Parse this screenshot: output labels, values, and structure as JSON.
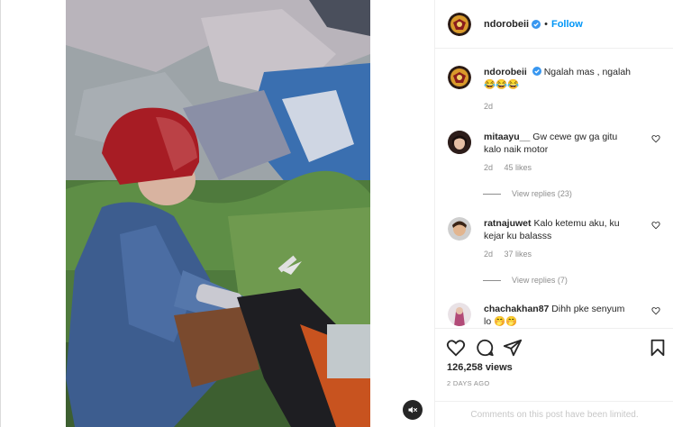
{
  "post": {
    "username": "ndorobeii",
    "follow_label": "Follow",
    "dot": "•"
  },
  "caption": {
    "username": "ndorobeii",
    "text": "Ngalah mas , ngalah 😂😂😂",
    "time": "2d"
  },
  "comments": [
    {
      "username": "mitaayu__",
      "text": "Gw cewe gw ga gitu kalo naik motor",
      "time": "2d",
      "likes": "45 likes",
      "view_replies": "View replies (23)"
    },
    {
      "username": "ratnajuwet",
      "text": "Kalo ketemu aku, ku kejar ku balasss",
      "time": "2d",
      "likes": "37 likes",
      "view_replies": "View replies (7)"
    },
    {
      "username": "chachakhan87",
      "text": "Dihh pke senyum lo 🤭🤭"
    }
  ],
  "stats": {
    "views": "126,258 views",
    "date": "2 DAYS AGO"
  },
  "footer": {
    "limited_text": "Comments on this post have been limited."
  },
  "icons": {
    "like": "heart-icon",
    "comment": "comment-icon",
    "share": "paper-plane-icon",
    "save": "bookmark-icon",
    "mute": "speaker-muted-icon",
    "verified": "verified-badge-icon"
  },
  "colors": {
    "link": "#0095f6",
    "text": "#262626",
    "secondary": "#8e8e8e",
    "verified": "#3897f0"
  }
}
